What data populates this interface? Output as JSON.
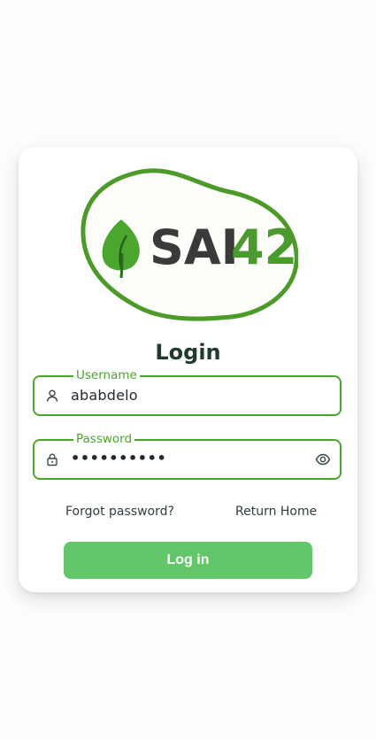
{
  "logo": {
    "text_sai": "SAI",
    "text_42": "42",
    "colors": {
      "outline": "#4c9a2a",
      "leaf": "#4aa62c",
      "sai": "#3a3a3a",
      "num": "#4a9a2e"
    }
  },
  "title": "Login",
  "username": {
    "label": "Username",
    "value": "ababdelo"
  },
  "password": {
    "label": "Password",
    "value": "••••••••••"
  },
  "links": {
    "forgot": "Forgot password?",
    "home": "Return Home"
  },
  "login_button": "Log in",
  "colors": {
    "accent": "#4aa62c",
    "button": "#63c66a"
  }
}
